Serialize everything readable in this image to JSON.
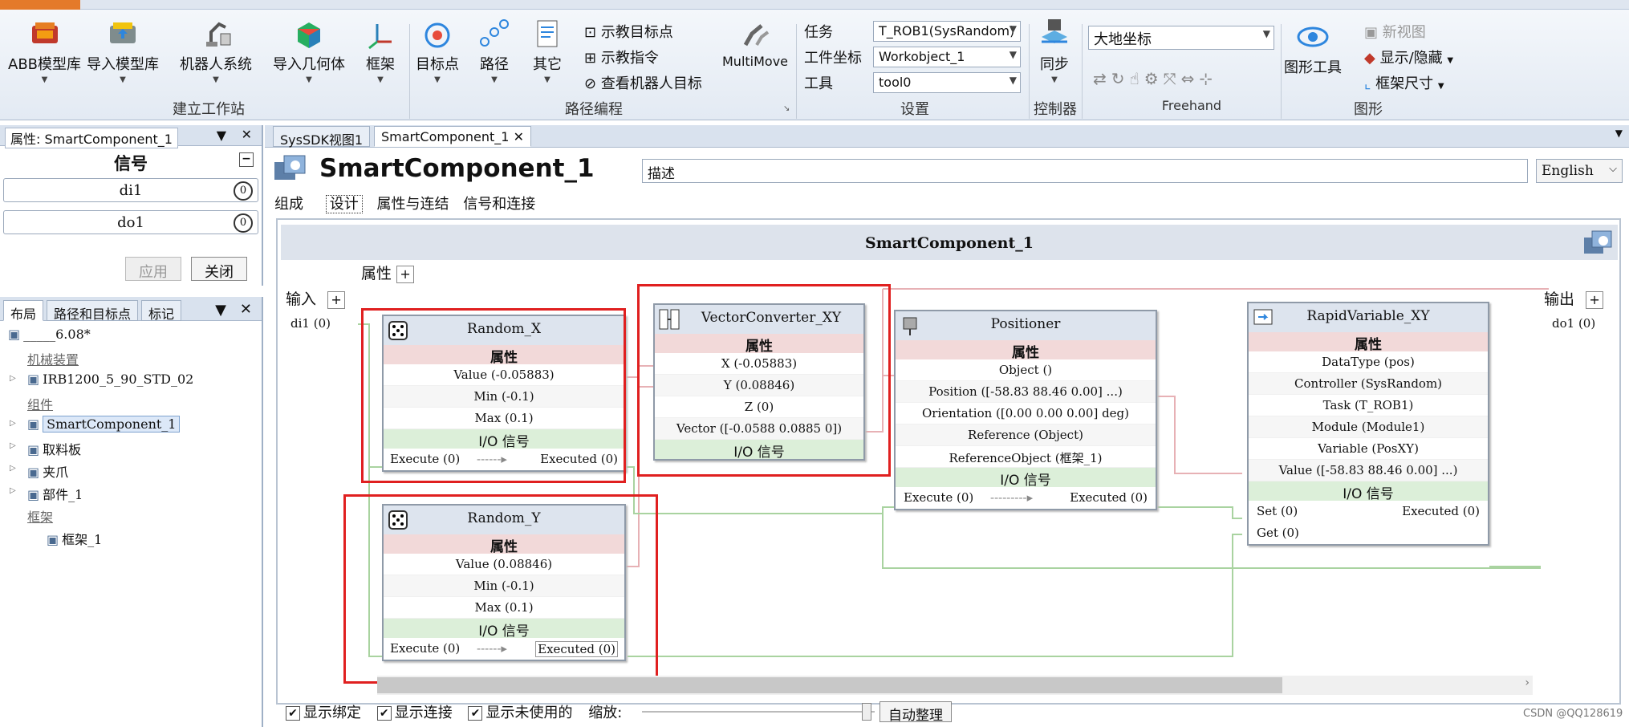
{
  "ribbon": {
    "buttons": {
      "abb_library": "ABB模型库",
      "import_library": "导入模型库",
      "robot_system": "机器人系统",
      "import_geometry": "导入几何体",
      "frame": "框架",
      "target": "目标点",
      "path": "路径",
      "other": "其它",
      "multimove": "MultiMove",
      "sync": "同步",
      "graphic_tools": "图形工具"
    },
    "small": {
      "teach_target": "示教目标点",
      "teach_instruction": "示教指令",
      "view_robot_target": "查看机器人目标",
      "new_view": "新视图",
      "show_hide": "显示/隐藏",
      "frame_size": "框架尺寸"
    },
    "settings": {
      "task_label": "任务",
      "workobject_label": "工件坐标",
      "tool_label": "工具",
      "task_value": "T_ROB1(SysRandom)",
      "workobject_value": "Workobject_1",
      "tool_value": "tool0",
      "freehand_value": "大地坐标"
    },
    "groups": {
      "build_station": "建立工作站",
      "path_programming": "路径编程",
      "settings": "设置",
      "controller": "控制器",
      "freehand": "Freehand",
      "graphics": "图形"
    }
  },
  "props_panel": {
    "title": "属性: SmartComponent_1",
    "section": "信号",
    "signals": [
      {
        "name": "di1",
        "value": "0"
      },
      {
        "name": "do1",
        "value": "0"
      }
    ],
    "apply": "应用",
    "close": "关闭"
  },
  "layout_panel": {
    "tabs": [
      "布局",
      "路径和目标点",
      "标记"
    ],
    "tree": [
      {
        "label": "_____6.08*",
        "kind": "item",
        "indent": 0
      },
      {
        "label": "机械装置",
        "kind": "header",
        "indent": 1
      },
      {
        "label": "IRB1200_5_90_STD_02",
        "kind": "item",
        "indent": 1
      },
      {
        "label": "组件",
        "kind": "header",
        "indent": 1
      },
      {
        "label": "SmartComponent_1",
        "kind": "selected",
        "indent": 1
      },
      {
        "label": "取料板",
        "kind": "item",
        "indent": 1
      },
      {
        "label": "夹爪",
        "kind": "item",
        "indent": 1
      },
      {
        "label": "部件_1",
        "kind": "item",
        "indent": 1
      },
      {
        "label": "框架",
        "kind": "header",
        "indent": 1
      },
      {
        "label": "框架_1",
        "kind": "item",
        "indent": 2
      }
    ]
  },
  "doc_tabs": [
    "SysSDK视图1",
    "SmartComponent_1"
  ],
  "editor": {
    "component_name": "SmartComponent_1",
    "description_placeholder": "描述",
    "language": "English",
    "subtabs": [
      "组成",
      "设计",
      "属性与连结",
      "信号和连接"
    ],
    "canvas_title": "SmartComponent_1",
    "properties_label": "属性",
    "input_label": "输入",
    "output_label": "输出",
    "input_signal": "di1 (0)",
    "output_signal": "do1 (0)"
  },
  "blocks": {
    "random_x": {
      "title": "Random_X",
      "props_header": "属性",
      "rows": [
        "Value (-0.05883)",
        "Min (-0.1)",
        "Max (0.1)"
      ],
      "io_header": "I/O 信号",
      "exec_in": "Execute (0)",
      "exec_out": "Executed (0)"
    },
    "random_y": {
      "title": "Random_Y",
      "props_header": "属性",
      "rows": [
        "Value (0.08846)",
        "Min (-0.1)",
        "Max (0.1)"
      ],
      "io_header": "I/O 信号",
      "exec_in": "Execute (0)",
      "exec_out": "Executed (0)"
    },
    "vector_converter": {
      "title": "VectorConverter_XY",
      "props_header": "属性",
      "rows": [
        "X (-0.05883)",
        "Y (0.08846)",
        "Z (0)",
        "Vector ([-0.0588 0.0885 0])"
      ],
      "io_header": "I/O 信号"
    },
    "positioner": {
      "title": "Positioner",
      "props_header": "属性",
      "rows": [
        "Object ()",
        "Position ([-58.83 88.46 0.00] ...)",
        "Orientation ([0.00 0.00 0.00] deg)",
        "Reference (Object)",
        "ReferenceObject (框架_1)"
      ],
      "io_header": "I/O 信号",
      "exec_in": "Execute (0)",
      "exec_out": "Executed (0)"
    },
    "rapid_variable": {
      "title": "RapidVariable_XY",
      "props_header": "属性",
      "rows": [
        "DataType (pos)",
        "Controller (SysRandom)",
        "Task (T_ROB1)",
        "Module (Module1)",
        "Variable (PosXY)",
        "Value ([-58.83 88.46 0.00] ...)"
      ],
      "io_header": "I/O 信号",
      "io_rows": [
        [
          "Set (0)",
          "Executed (0)"
        ],
        [
          "Get (0)",
          ""
        ]
      ]
    }
  },
  "bottom_bar": {
    "show_bindings": "显示绑定",
    "show_connections": "显示连接",
    "show_unused": "显示未使用的",
    "zoom_label": "缩放:",
    "auto_arrange": "自动整理"
  },
  "watermark": "CSDN @QQ128619"
}
